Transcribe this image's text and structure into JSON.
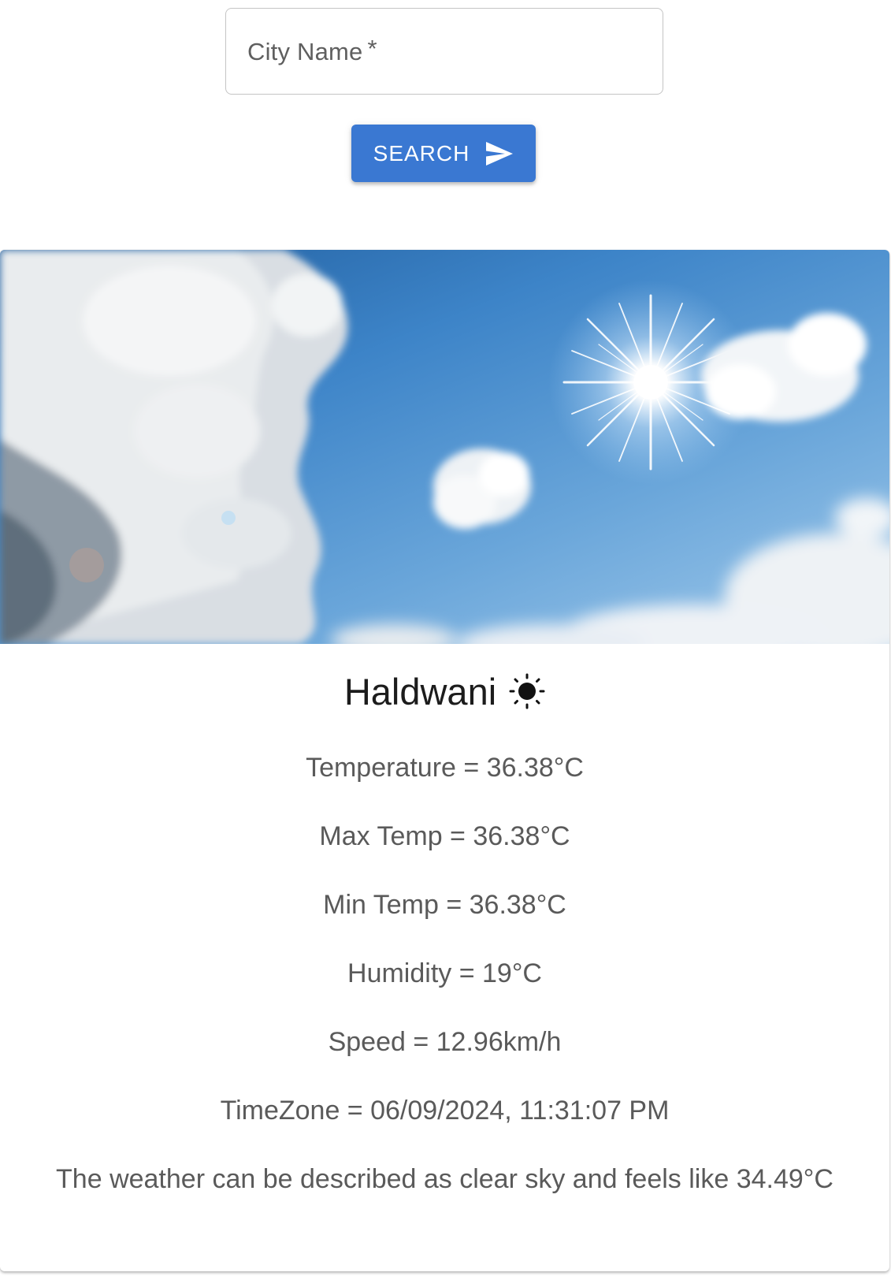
{
  "search": {
    "placeholder": "City Name",
    "required_mark": "*",
    "value": "",
    "button_label": "SEARCH",
    "button_icon": "send-icon",
    "accent_color": "#3a78d2"
  },
  "weather": {
    "city": "Haldwani",
    "condition_icon": "sun-icon",
    "temperature": "Temperature = 36.38°C",
    "max_temp": "Max Temp = 36.38°C",
    "min_temp": "Min Temp = 36.38°C",
    "humidity": "Humidity = 19°C",
    "speed": "Speed = 12.96km/h",
    "timezone": "TimeZone = 06/09/2024, 11:31:07 PM",
    "description": "The weather can be described as clear sky and feels like 34.49°C"
  }
}
